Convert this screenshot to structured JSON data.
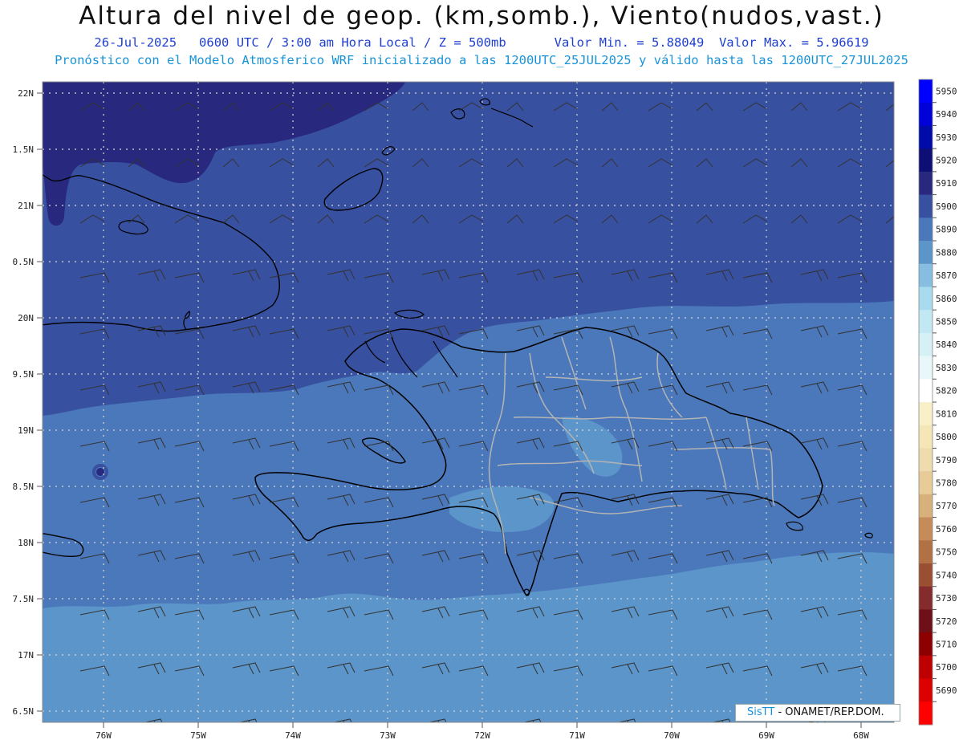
{
  "header": {
    "title": "Altura del nivel de geop. (km,somb.), Viento(nudos,vast.)",
    "date": "26-Jul-2025",
    "time_info": "0600 UTC / 3:00 am Hora Local / Z = 500mb",
    "min_value": "Valor Min. = 5.88049",
    "max_value": "Valor Max. = 5.96619",
    "model_info": "Pronóstico con el Modelo Atmosferico WRF inicializado a las 1200UTC_25JUL2025 y válido hasta las  1200UTC_27JUL2025"
  },
  "axes": {
    "lat_labels": [
      "22N",
      "1.5N",
      "21N",
      "0.5N",
      "20N",
      "9.5N",
      "19N",
      "8.5N",
      "18N",
      "7.5N",
      "17N",
      "6.5N"
    ],
    "lon_labels": [
      "76W",
      "75W",
      "74W",
      "73W",
      "72W",
      "71W",
      "70W",
      "69W",
      "68W"
    ]
  },
  "colorbar": {
    "levels": [
      "5950",
      "5940",
      "5930",
      "5920",
      "5910",
      "5900",
      "5890",
      "5880",
      "5870",
      "5860",
      "5850",
      "5840",
      "5830",
      "5820",
      "5810",
      "5800",
      "5790",
      "5780",
      "5770",
      "5760",
      "5750",
      "5740",
      "5730",
      "5720",
      "5710",
      "5700",
      "5690"
    ],
    "colors": [
      "#0000ff",
      "#0000d8",
      "#000aa8",
      "#0e0f74",
      "#27287e",
      "#3850a0",
      "#4a78bb",
      "#5c95c9",
      "#86bde0",
      "#a8dbed",
      "#c1e8f3",
      "#d5f1f6",
      "#e8f8fa",
      "#ffffff",
      "#f9f0c9",
      "#f4e6b6",
      "#efdcae",
      "#e7cc98",
      "#d7b07b",
      "#c58c5a",
      "#b27045",
      "#9a4f33",
      "#842b2b",
      "#6e1018",
      "#8c0000",
      "#bf0000",
      "#dd0000",
      "#ff0000"
    ]
  },
  "colors": {
    "fill_5910": "#27287e",
    "fill_5900": "#3850a0",
    "fill_5890": "#4a78bb",
    "fill_5880": "#5c95c9",
    "fill_5870": "#86bde0",
    "coast": "#000000",
    "provinces": "#b4b4b4",
    "grid": "#d0d0d0"
  },
  "credit": {
    "brand": "SisTT",
    "text": "- ONAMET/REP.DOM."
  }
}
